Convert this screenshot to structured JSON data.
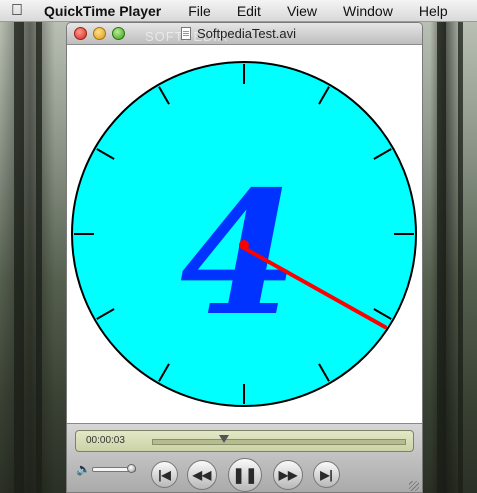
{
  "menubar": {
    "app_name": "QuickTime Player",
    "items": [
      "File",
      "Edit",
      "View",
      "Window",
      "Help"
    ]
  },
  "window": {
    "title": "SoftpediaTest.avi",
    "watermark": "SOFTPEDIA"
  },
  "video": {
    "digit": "4",
    "face_color": "#00ffff",
    "digit_color": "#0033ff",
    "hand_color": "#ff0000"
  },
  "controller": {
    "timecode": "00:00:03",
    "playhead_fraction": 0.28,
    "volume_fraction": 0.9,
    "icons": [
      "skip-to-start-icon",
      "rewind-icon",
      "pause-icon",
      "fast-forward-icon",
      "skip-to-end-icon",
      "speaker-icon"
    ]
  }
}
